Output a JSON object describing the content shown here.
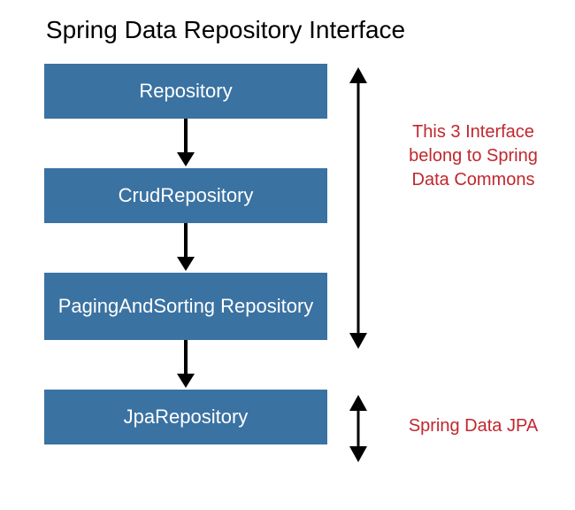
{
  "title": "Spring Data Repository Interface",
  "boxes": {
    "b1": "Repository",
    "b2": "CrudRepository",
    "b3": "PagingAndSorting Repository",
    "b4": "JpaRepository"
  },
  "annotations": {
    "upper": "This 3 Interface belong to Spring Data Commons",
    "lower": "Spring Data JPA"
  }
}
